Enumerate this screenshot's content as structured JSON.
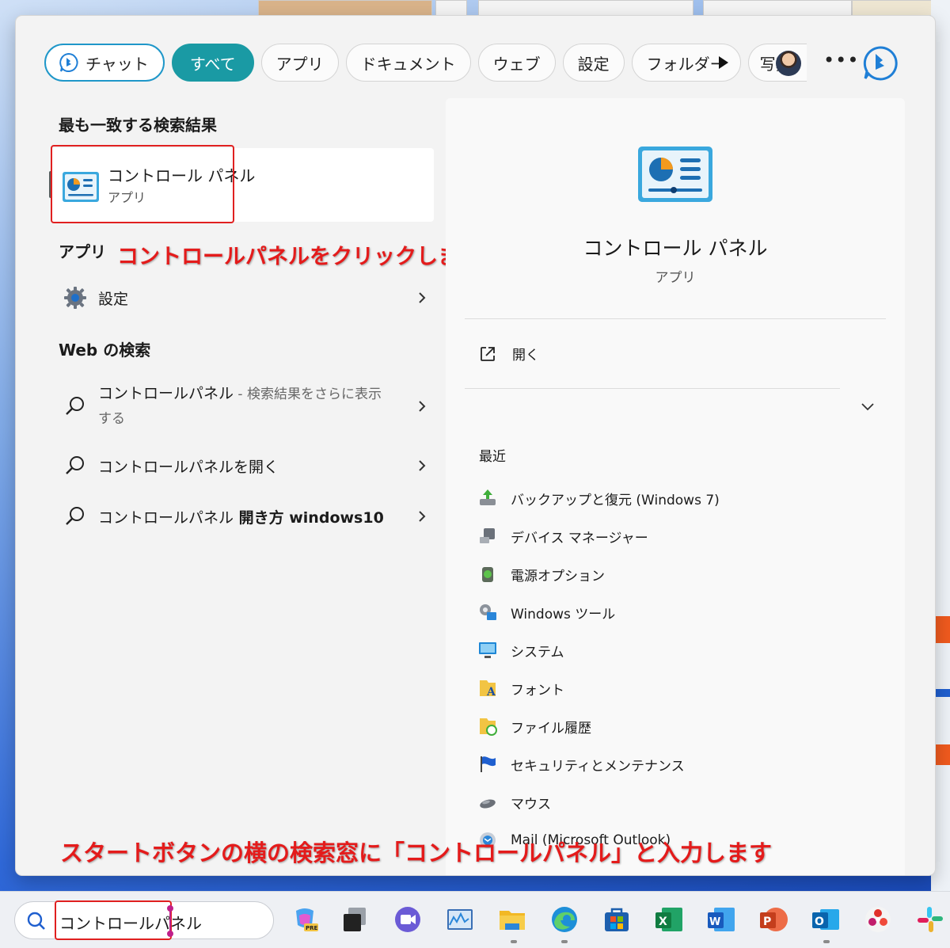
{
  "filters": {
    "chat": "チャット",
    "all": "すべて",
    "apps": "アプリ",
    "documents": "ドキュメント",
    "web": "ウェブ",
    "settings": "設定",
    "folders": "フォルダー",
    "photos": "写真"
  },
  "left": {
    "best_match_title": "最も一致する検索結果",
    "best_match": {
      "name": "コントロール パネル",
      "type": "アプリ"
    },
    "apps_title": "アプリ",
    "apps": [
      {
        "name": "設定"
      }
    ],
    "web_title": "Web の検索",
    "web_results": [
      {
        "query": "コントロールパネル",
        "suffix": " - 検索結果をさらに表示",
        "suffix2": "する"
      },
      {
        "query": "コントロールパネルを開く"
      },
      {
        "query": "コントロールパネル",
        "bold": " 開き方 windows10"
      }
    ]
  },
  "detail": {
    "title": "コントロール パネル",
    "subtitle": "アプリ",
    "open": "開く",
    "recent_title": "最近",
    "recent": [
      {
        "label": "バックアップと復元 (Windows 7)",
        "icon": "backup-restore-icon"
      },
      {
        "label": "デバイス マネージャー",
        "icon": "device-manager-icon"
      },
      {
        "label": "電源オプション",
        "icon": "power-options-icon"
      },
      {
        "label": "Windows ツール",
        "icon": "windows-tools-icon"
      },
      {
        "label": "システム",
        "icon": "system-icon"
      },
      {
        "label": "フォント",
        "icon": "fonts-icon"
      },
      {
        "label": "ファイル履歴",
        "icon": "file-history-icon"
      },
      {
        "label": "セキュリティとメンテナンス",
        "icon": "security-maintenance-icon"
      },
      {
        "label": "マウス",
        "icon": "mouse-icon"
      },
      {
        "label": "Mail (Microsoft Outlook)",
        "icon": "mail-icon"
      }
    ]
  },
  "annotations": {
    "click_hint": "コントロールパネルをクリックします",
    "type_hint": "スタートボタンの横の検索窓に「コントロールパネル」と入力します"
  },
  "taskbar": {
    "search_value": "コントロールパネル",
    "apps": [
      "copilot-icon",
      "task-view-icon",
      "teams-icon",
      "resource-monitor-icon",
      "file-explorer-icon",
      "edge-icon",
      "store-icon",
      "excel-icon",
      "word-icon",
      "powerpoint-icon",
      "outlook-icon",
      "colorful-app-icon",
      "slack-icon"
    ]
  },
  "colors": {
    "accent": "#1a9aa4",
    "annotation": "#e41b1b",
    "chat_border": "#1f97c9"
  }
}
